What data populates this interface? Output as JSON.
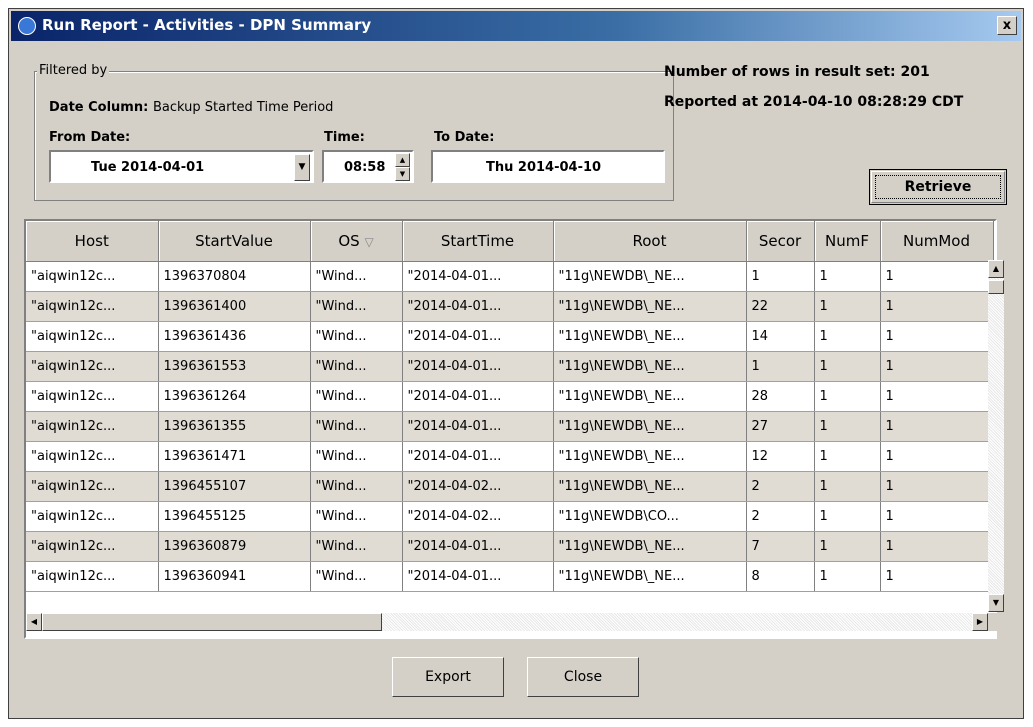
{
  "window": {
    "title": "Run Report - Activities - DPN Summary",
    "close_label": "x"
  },
  "filter": {
    "group_label": "Filtered by",
    "date_column_label": "Date Column:",
    "date_column_value": "Backup Started Time Period",
    "from_date_label": "From Date:",
    "from_date_value": "Tue 2014-04-01",
    "time_label": "Time:",
    "time_value": "08:58",
    "to_date_label": "To Date:",
    "to_date_value": "Thu 2014-04-10"
  },
  "summary": {
    "rows_text": "Number of rows in result set: 201",
    "reported_text": "Reported at 2014-04-10 08:28:29 CDT"
  },
  "buttons": {
    "retrieve": "Retrieve",
    "export": "Export",
    "close": "Close"
  },
  "table": {
    "columns": [
      "Host",
      "StartValue",
      "OS",
      "StartTime",
      "Root",
      "Secor",
      "NumF",
      "NumMod"
    ],
    "sort_indicator": "▽",
    "rows": [
      [
        "\"aiqwin12c...",
        "1396370804",
        "\"Wind...",
        "\"2014-04-01...",
        "\"11g\\NEWDB\\_NE...",
        "1",
        "1",
        "1"
      ],
      [
        "\"aiqwin12c...",
        "1396361400",
        "\"Wind...",
        "\"2014-04-01...",
        "\"11g\\NEWDB\\_NE...",
        "22",
        "1",
        "1"
      ],
      [
        "\"aiqwin12c...",
        "1396361436",
        "\"Wind...",
        "\"2014-04-01...",
        "\"11g\\NEWDB\\_NE...",
        "14",
        "1",
        "1"
      ],
      [
        "\"aiqwin12c...",
        "1396361553",
        "\"Wind...",
        "\"2014-04-01...",
        "\"11g\\NEWDB\\_NE...",
        "1",
        "1",
        "1"
      ],
      [
        "\"aiqwin12c...",
        "1396361264",
        "\"Wind...",
        "\"2014-04-01...",
        "\"11g\\NEWDB\\_NE...",
        "28",
        "1",
        "1"
      ],
      [
        "\"aiqwin12c...",
        "1396361355",
        "\"Wind...",
        "\"2014-04-01...",
        "\"11g\\NEWDB\\_NE...",
        "27",
        "1",
        "1"
      ],
      [
        "\"aiqwin12c...",
        "1396361471",
        "\"Wind...",
        "\"2014-04-01...",
        "\"11g\\NEWDB\\_NE...",
        "12",
        "1",
        "1"
      ],
      [
        "\"aiqwin12c...",
        "1396455107",
        "\"Wind...",
        "\"2014-04-02...",
        "\"11g\\NEWDB\\_NE...",
        "2",
        "1",
        "1"
      ],
      [
        "\"aiqwin12c...",
        "1396455125",
        "\"Wind...",
        "\"2014-04-02...",
        "\"11g\\NEWDB\\CO...",
        "2",
        "1",
        "1"
      ],
      [
        "\"aiqwin12c...",
        "1396360879",
        "\"Wind...",
        "\"2014-04-01...",
        "\"11g\\NEWDB\\_NE...",
        "7",
        "1",
        "1"
      ],
      [
        "\"aiqwin12c...",
        "1396360941",
        "\"Wind...",
        "\"2014-04-01...",
        "\"11g\\NEWDB\\_NE...",
        "8",
        "1",
        "1"
      ]
    ]
  }
}
